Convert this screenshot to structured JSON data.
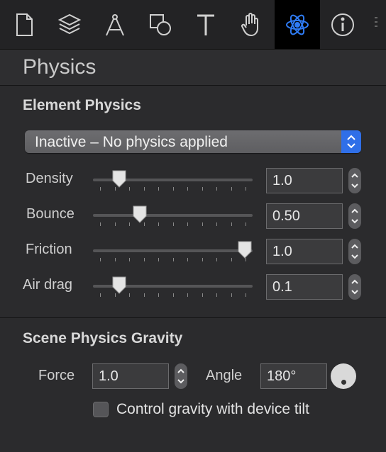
{
  "toolbar": {
    "icons": [
      "document-icon",
      "layers-icon",
      "compass-icon",
      "shapes-icon",
      "text-icon",
      "hand-icon",
      "physics-atom-icon",
      "info-icon"
    ],
    "active_icon": "physics-atom-icon",
    "accent_color": "#2f7cf6"
  },
  "panel": {
    "title": "Physics"
  },
  "element_physics": {
    "title": "Element Physics",
    "mode_select": {
      "value": "Inactive – No physics applied"
    },
    "rows": [
      {
        "label": "Density",
        "value": "1.0",
        "slider_fraction": 0.13
      },
      {
        "label": "Bounce",
        "value": "0.50",
        "slider_fraction": 0.27
      },
      {
        "label": "Friction",
        "value": "1.0",
        "slider_fraction": 1.0
      },
      {
        "label": "Air drag",
        "value": "0.1",
        "slider_fraction": 0.13
      }
    ]
  },
  "scene_gravity": {
    "title": "Scene Physics Gravity",
    "force_label": "Force",
    "force_value": "1.0",
    "angle_label": "Angle",
    "angle_value": "180°",
    "tilt_checkbox_label": "Control gravity with device tilt",
    "tilt_checked": false
  }
}
